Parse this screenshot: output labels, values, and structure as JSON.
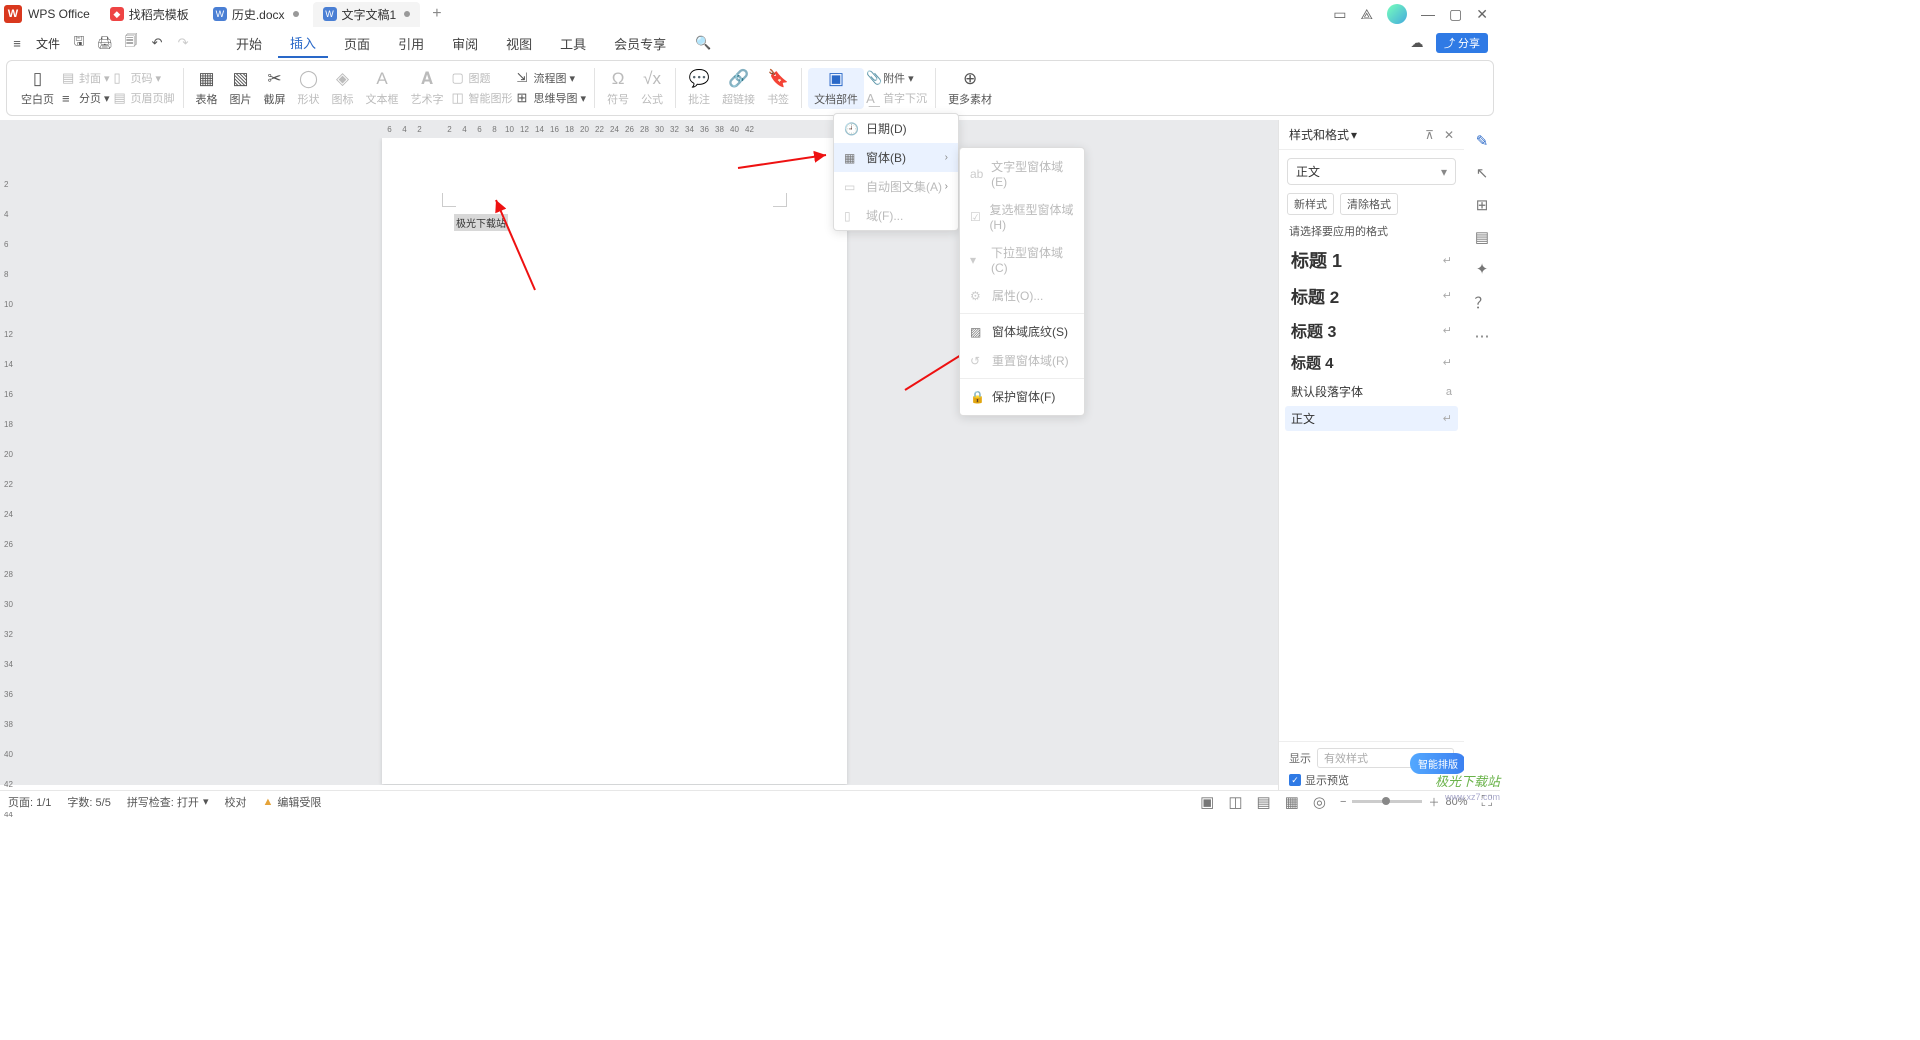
{
  "titlebar": {
    "app": "WPS Office",
    "tabs": [
      {
        "label": "找稻壳模板",
        "icon": "red"
      },
      {
        "label": "历史.docx",
        "icon": "blue",
        "modified": true
      },
      {
        "label": "文字文稿1",
        "icon": "blue",
        "modified": true,
        "active": true
      }
    ]
  },
  "menubar": {
    "file": "文件",
    "tabs": [
      "开始",
      "插入",
      "页面",
      "引用",
      "审阅",
      "视图",
      "工具",
      "会员专享"
    ],
    "active": "插入",
    "share": "分享"
  },
  "ribbon": {
    "blank": "空白页",
    "cover": "封面",
    "pagenum": "页码",
    "paging": "分页",
    "headerfooter": "页眉页脚",
    "table": "表格",
    "picture": "图片",
    "screenshot": "截屏",
    "shape": "形状",
    "icon": "图标",
    "textbox": "文本框",
    "wordart": "艺术字",
    "pictitle": "图题",
    "smartart": "智能图形",
    "flowchart": "流程图",
    "mindmap": "思维导图",
    "symbol": "符号",
    "formula": "公式",
    "comment": "批注",
    "hyperlink": "超链接",
    "bookmark": "书签",
    "docpart": "文档部件",
    "attach": "附件",
    "dropcap": "首字下沉",
    "more": "更多素材"
  },
  "dd1": {
    "date": "日期(D)",
    "form": "窗体(B)",
    "autotext": "自动图文集(A)",
    "field": "域(F)..."
  },
  "dd2": {
    "textform": "文字型窗体域(E)",
    "checkbox": "复选框型窗体域(H)",
    "dropdown": "下拉型窗体域(C)",
    "props": "属性(O)...",
    "shading": "窗体域底纹(S)",
    "reset": "重置窗体域(R)",
    "protect": "保护窗体(F)"
  },
  "page": {
    "text": "极光下载站"
  },
  "hruler": [
    "6",
    "4",
    "2",
    "",
    "2",
    "4",
    "6",
    "8",
    "10",
    "12",
    "14",
    "16",
    "18",
    "20",
    "22",
    "24",
    "26",
    "28",
    "30",
    "32",
    "34",
    "36",
    "38",
    "40",
    "42"
  ],
  "vruler": [
    "",
    "2",
    "4",
    "6",
    "8",
    "10",
    "12",
    "14",
    "16",
    "18",
    "20",
    "22",
    "24",
    "26",
    "28",
    "30",
    "32",
    "34",
    "36",
    "38",
    "40",
    "42",
    "44"
  ],
  "rightpanel": {
    "title": "样式和格式",
    "current": "正文",
    "newstyle": "新样式",
    "clear": "清除格式",
    "pick": "请选择要应用的格式",
    "items": [
      {
        "label": "标题 1",
        "cls": "h1t"
      },
      {
        "label": "标题 2",
        "cls": "h2t"
      },
      {
        "label": "标题 3",
        "cls": "h3t"
      },
      {
        "label": "标题 4",
        "cls": "h4t"
      },
      {
        "label": "默认段落字体",
        "cls": "deft",
        "lock": true
      },
      {
        "label": "正文",
        "cls": "bodyt",
        "selected": true
      }
    ],
    "display": "显示",
    "displayVal": "有效样式",
    "preview": "显示预览",
    "smart": "智能排版"
  },
  "status": {
    "page": "页面: 1/1",
    "words": "字数: 5/5",
    "spell": "拼写检查: 打开",
    "proof": "校对",
    "restrict": "编辑受限",
    "zoom": "80%"
  },
  "watermark": {
    "a": "极光下载站",
    "b": "www.xz7.com"
  }
}
